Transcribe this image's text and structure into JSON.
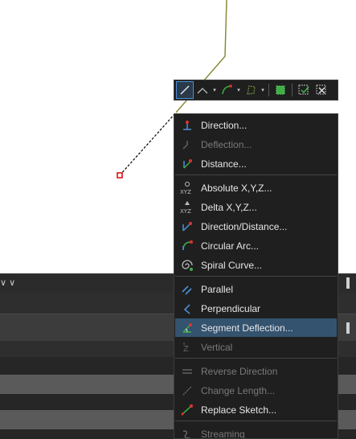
{
  "toolbar": {
    "buttons": [
      {
        "icon": "straight-line-icon",
        "active": true
      },
      {
        "icon": "angle-line-icon"
      },
      {
        "icon": "curve-arc-icon"
      },
      {
        "icon": "trace-polygon-icon"
      },
      {
        "icon": "green-select-icon"
      },
      {
        "icon": "finish-sketch-icon"
      },
      {
        "icon": "clear-sketch-icon"
      }
    ]
  },
  "menu": {
    "items": [
      {
        "label": "Direction...",
        "icon": "direction-icon",
        "enabled": true
      },
      {
        "label": "Deflection...",
        "icon": "deflection-icon",
        "enabled": false
      },
      {
        "label": "Distance...",
        "icon": "distance-icon",
        "enabled": true
      },
      {
        "label": "Absolute X,Y,Z...",
        "icon": "absolute-xyz-icon",
        "enabled": true
      },
      {
        "label": "Delta X,Y,Z...",
        "icon": "delta-xyz-icon",
        "enabled": true
      },
      {
        "label": "Direction/Distance...",
        "icon": "direction-distance-icon",
        "enabled": true
      },
      {
        "label": "Circular Arc...",
        "icon": "circular-arc-icon",
        "enabled": true
      },
      {
        "label": "Spiral Curve...",
        "icon": "spiral-curve-icon",
        "enabled": true
      },
      {
        "label": "Parallel",
        "icon": "parallel-icon",
        "enabled": true
      },
      {
        "label": "Perpendicular",
        "icon": "perpendicular-icon",
        "enabled": true
      },
      {
        "label": "Segment Deflection...",
        "icon": "segment-deflection-icon",
        "enabled": true,
        "highlighted": true
      },
      {
        "label": "Vertical",
        "icon": "vertical-icon",
        "enabled": false
      },
      {
        "label": "Reverse Direction",
        "icon": "reverse-direction-icon",
        "enabled": false
      },
      {
        "label": "Change Length...",
        "icon": "change-length-icon",
        "enabled": false
      },
      {
        "label": "Replace Sketch...",
        "icon": "replace-sketch-icon",
        "enabled": true
      },
      {
        "label": "Streaming",
        "icon": "streaming-icon",
        "enabled": false
      }
    ]
  },
  "colors": {
    "menu_bg": "#1f1f1f",
    "highlight": "#34536f",
    "text": "#e6e6e6",
    "disabled_text": "#7a7a7a",
    "accent_blue": "#4a90d9",
    "accent_green": "#3cb043",
    "sketch_line": "#8a8a3a"
  }
}
